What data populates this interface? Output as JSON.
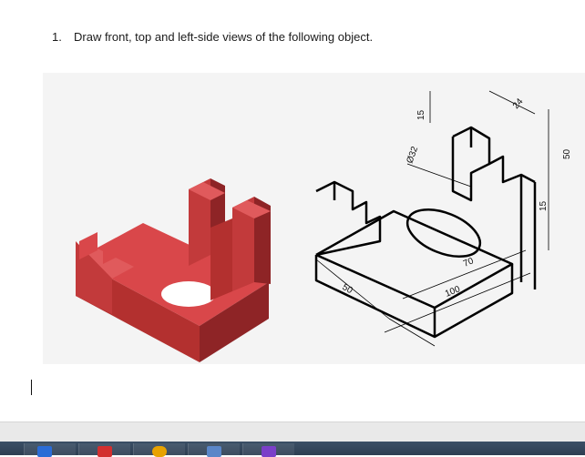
{
  "question": {
    "number": "1.",
    "text": "Draw front, top and left-side views of the following object."
  },
  "drawing": {
    "dimensions": {
      "d15_top": "15",
      "d32": "Ø32",
      "d24": "24",
      "d50_right": "50",
      "d15_right": "15",
      "d70": "70",
      "d100": "100",
      "d50_bottom": "50"
    }
  },
  "colors": {
    "model_red": "#c8383a",
    "model_dark": "#8e2426",
    "figure_bg": "#f4f4f4"
  },
  "taskbar": {
    "items": [
      {
        "icon": "word-icon",
        "color": "#2b6cd6"
      },
      {
        "icon": "autocad-icon",
        "color": "#d32f2f"
      },
      {
        "icon": "chrome-icon",
        "color": "#e8a200"
      },
      {
        "icon": "taskview-icon",
        "color": "#5a86c8"
      },
      {
        "icon": "onenote-icon",
        "color": "#7b3fc9"
      }
    ]
  }
}
